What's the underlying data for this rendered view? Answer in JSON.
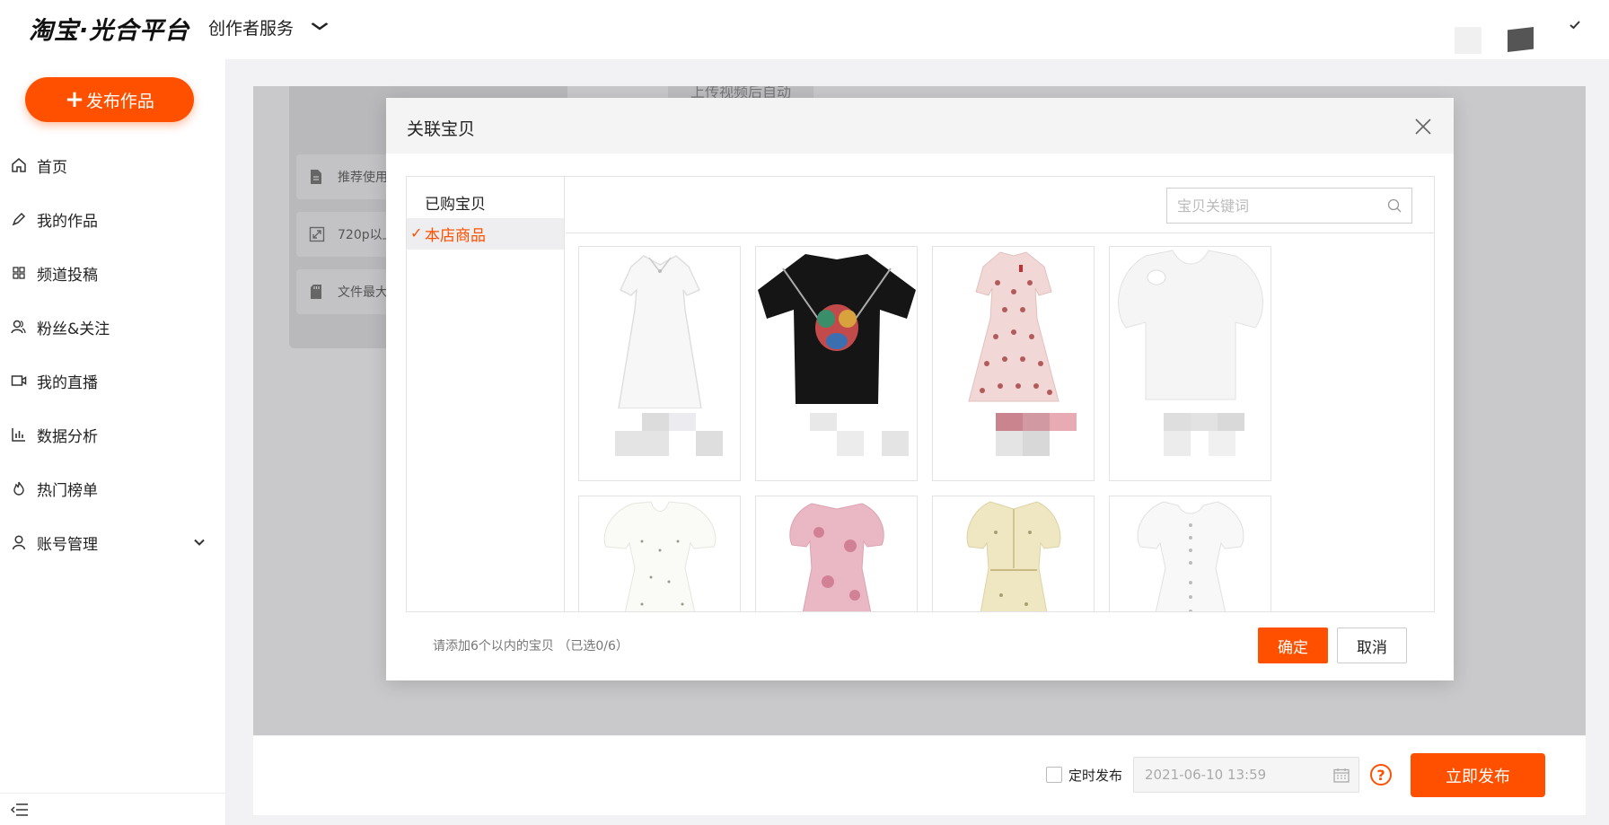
{
  "app": {
    "logo": "淘宝·光合平台",
    "service_label": "创作者服务"
  },
  "sidebar": {
    "publish_label": "发布作品",
    "items": [
      {
        "label": "首页",
        "icon": "home-icon"
      },
      {
        "label": "我的作品",
        "icon": "pen-icon"
      },
      {
        "label": "频道投稿",
        "icon": "grid-icon"
      },
      {
        "label": "粉丝&关注",
        "icon": "users-icon"
      },
      {
        "label": "我的直播",
        "icon": "video-icon"
      },
      {
        "label": "数据分析",
        "icon": "bar-chart-icon"
      },
      {
        "label": "热门榜单",
        "icon": "flame-icon"
      },
      {
        "label": "账号管理",
        "icon": "user-icon"
      }
    ]
  },
  "background_page": {
    "upload_hint": "上传视频后自动",
    "requirements": [
      {
        "label": "推荐使用",
        "icon": "document-icon"
      },
      {
        "label": "720p以上",
        "icon": "resize-icon"
      },
      {
        "label": "文件最大",
        "icon": "sd-card-icon"
      }
    ]
  },
  "modal": {
    "title": "关联宝贝",
    "tabs": [
      {
        "label": "已购宝贝",
        "active": false
      },
      {
        "label": "本店商品",
        "active": true
      }
    ],
    "search_placeholder": "宝贝关键词",
    "products": [
      {
        "name": "white-dress"
      },
      {
        "name": "black-embroidered-top"
      },
      {
        "name": "pink-polka-dress"
      },
      {
        "name": "white-cutout-top"
      },
      {
        "name": "white-floral-dress"
      },
      {
        "name": "pink-floral-dress"
      },
      {
        "name": "yellow-floral-dress"
      },
      {
        "name": "white-button-dress"
      }
    ],
    "note": "请添加6个以内的宝贝  （已选0/6）",
    "confirm_label": "确定",
    "cancel_label": "取消"
  },
  "footer": {
    "schedule_label": "定时发布",
    "schedule_datetime": "2021-06-10 13:59",
    "help_label": "?",
    "publish_now_label": "立即发布"
  },
  "colors": {
    "accent": "#ff5000",
    "overlay": "#c9c9cb"
  }
}
